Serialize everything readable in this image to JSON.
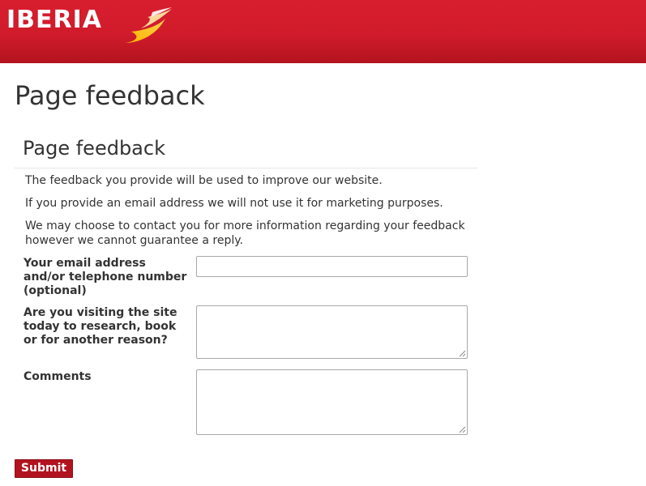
{
  "header": {
    "logo_text": "IBERIA",
    "brand_color": "#d81e2e",
    "logo_mark_icon": "iberia-swoosh-icon"
  },
  "page": {
    "title": "Page feedback"
  },
  "form": {
    "section_title": "Page feedback",
    "intro": [
      "The feedback you provide will be used to improve our website.",
      "If you provide an email address we will not use it for marketing purposes.",
      "We may choose to contact you for more information regarding your feedback however we cannot guarantee a reply."
    ],
    "fields": {
      "contact": {
        "label": "Your email address and/or telephone number (optional)",
        "value": ""
      },
      "reason": {
        "label": "Are you visiting the site today to research, book or for another reason?",
        "value": ""
      },
      "comments": {
        "label": "Comments",
        "value": ""
      }
    },
    "submit_label": "Submit",
    "submit_color": "#b3131f"
  }
}
